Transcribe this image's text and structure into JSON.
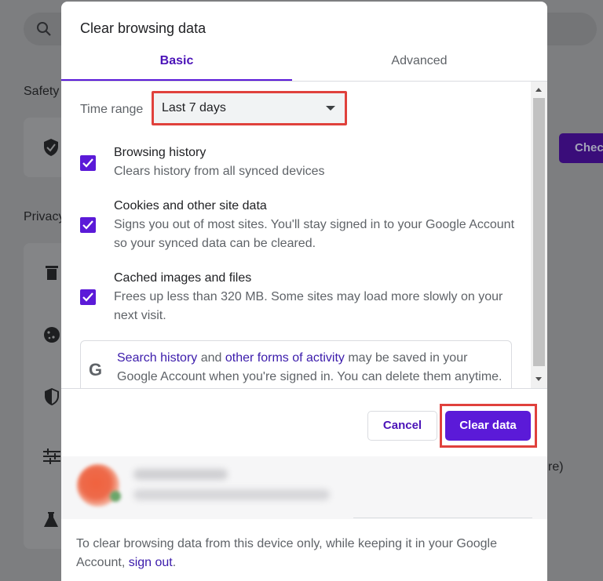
{
  "background": {
    "safety_heading": "Safety",
    "privacy_heading": "Privacy",
    "check_button": "Chec",
    "truncated_text": "re)"
  },
  "dialog": {
    "title": "Clear browsing data",
    "tabs": [
      {
        "label": "Basic",
        "selected": true
      },
      {
        "label": "Advanced",
        "selected": false
      }
    ],
    "time_range": {
      "label": "Time range",
      "value": "Last 7 days"
    },
    "options": [
      {
        "title": "Browsing history",
        "description": "Clears history from all synced devices",
        "checked": true
      },
      {
        "title": "Cookies and other site data",
        "description": "Signs you out of most sites. You'll stay signed in to your Google Account so your synced data can be cleared.",
        "checked": true
      },
      {
        "title": "Cached images and files",
        "description": "Frees up less than 320 MB. Some sites may load more slowly on your next visit.",
        "checked": true
      }
    ],
    "info": {
      "icon_letter": "G",
      "link1": "Search history",
      "text1": " and ",
      "link2": "other forms of activity",
      "text2": " may be saved in your Google Account when you're signed in. You can delete them anytime."
    },
    "buttons": {
      "cancel": "Cancel",
      "clear": "Clear data"
    },
    "footer": {
      "text": "To clear browsing data from this device only, while keeping it in your Google Account, ",
      "link": "sign out",
      "end": "."
    }
  },
  "colors": {
    "accent": "#5b1ad8",
    "highlight": "#e0413c",
    "link": "#3b1bab"
  }
}
